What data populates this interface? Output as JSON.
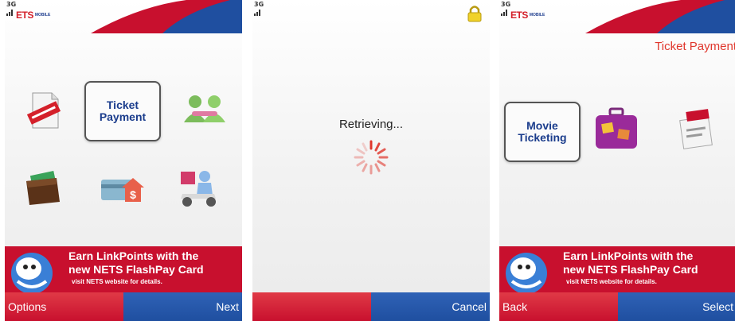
{
  "status": {
    "network": "3G"
  },
  "brand": {
    "logo": "ETS",
    "logo_sub": "MOBILE"
  },
  "screen1": {
    "tiles": [
      {
        "icon": "receipt-stamp-icon"
      },
      {
        "label_l1": "Ticket",
        "label_l2": "Payment",
        "selected": true
      },
      {
        "icon": "people-icon"
      },
      {
        "icon": "wallet-icon"
      },
      {
        "icon": "card-topup-icon"
      },
      {
        "icon": "delivery-scooter-icon"
      }
    ],
    "softkeys": {
      "left": "Options",
      "right": "Next"
    }
  },
  "screen2": {
    "status_text": "Retrieving...",
    "softkeys": {
      "left": "",
      "right": "Cancel"
    }
  },
  "screen3": {
    "heading": "Ticket Payment",
    "tiles": [
      {
        "label_l1": "Movie",
        "label_l2": "Ticketing",
        "selected": true
      },
      {
        "icon": "luggage-icon"
      },
      {
        "icon": "nets-ticket-icon"
      }
    ],
    "softkeys": {
      "left": "Back",
      "right": "Select"
    }
  },
  "banner": {
    "line1": "Earn LinkPoints with the",
    "line2": "new NETS FlashPay Card",
    "line3": "visit NETS website for details."
  },
  "colors": {
    "brand_red": "#c8102e",
    "brand_blue": "#1f4fa0",
    "label_blue": "#1a3c8c",
    "heading_red": "#e0362c"
  }
}
